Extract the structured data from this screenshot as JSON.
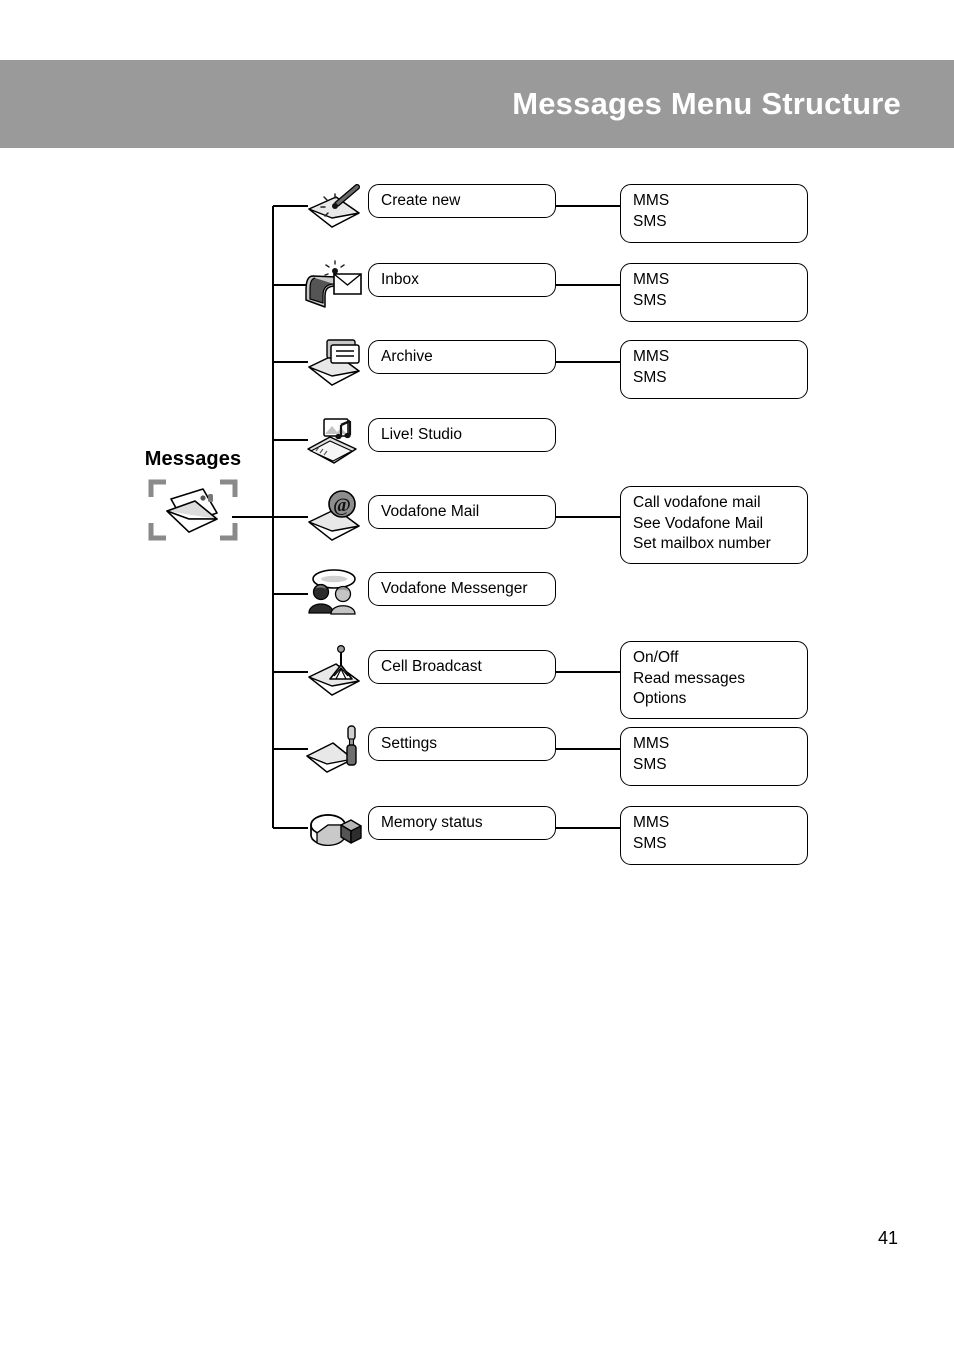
{
  "header": {
    "title": "Messages Menu Structure",
    "background_color": "#9a9a9a",
    "text_color": "#ffffff"
  },
  "root": {
    "label": "Messages",
    "icon": "envelope-in-brackets-icon"
  },
  "page": {
    "number": "41"
  },
  "diagram": {
    "type": "menu-tree",
    "rows": [
      {
        "icon": "envelope-wand-icon",
        "label": "Create new",
        "submenu": [
          "MMS",
          "SMS"
        ]
      },
      {
        "icon": "inbox-tray-envelope-icon",
        "label": "Inbox",
        "submenu": [
          "MMS",
          "SMS"
        ]
      },
      {
        "icon": "envelope-archive-icon",
        "label": "Archive",
        "submenu": [
          "MMS",
          "SMS"
        ]
      },
      {
        "icon": "notepad-media-icon",
        "label": "Live! Studio",
        "submenu": []
      },
      {
        "icon": "envelope-at-sign-icon",
        "label": "Vodafone Mail",
        "submenu": [
          "Call vodafone mail",
          "See Vodafone Mail",
          "Set mailbox number"
        ]
      },
      {
        "icon": "two-people-chat-icon",
        "label": "Vodafone Messenger",
        "submenu": []
      },
      {
        "icon": "envelope-antenna-icon",
        "label": "Cell Broadcast",
        "submenu": [
          "On/Off",
          "Read messages",
          "Options"
        ]
      },
      {
        "icon": "envelope-screwdriver-icon",
        "label": "Settings",
        "submenu": [
          "MMS",
          "SMS"
        ]
      },
      {
        "icon": "pie-chart-memory-icon",
        "label": "Memory status",
        "submenu": [
          "MMS",
          "SMS"
        ]
      }
    ]
  }
}
